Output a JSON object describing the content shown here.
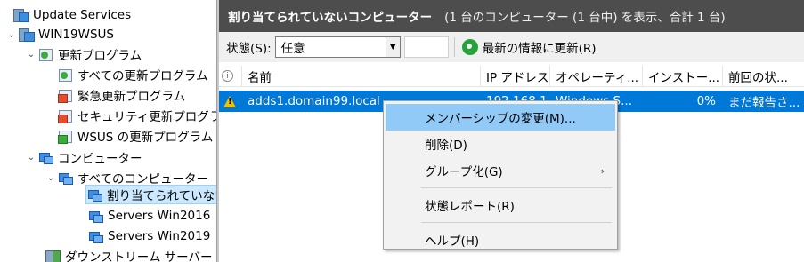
{
  "tree": {
    "root": "Update Services",
    "server": "WIN19WSUS",
    "updates": "更新プログラム",
    "all_updates": "すべての更新プログラム",
    "critical_updates": "緊急更新プログラム",
    "security_updates": "セキュリティ更新プログラ",
    "wsus_updates": "WSUS の更新プログラム",
    "computers": "コンピューター",
    "all_computers": "すべてのコンピューター",
    "unassigned": "割り当てられていない",
    "group_win2016": "Servers Win2016",
    "group_win2019": "Servers Win2019",
    "downstream": "ダウンストリーム サーバー"
  },
  "header": {
    "title": "割り当てられていないコンピューター",
    "info": "(1 台のコンピューター (1 台中) を表示、合計 1 台)"
  },
  "toolbar": {
    "status_label": "状態(S):",
    "status_value": "任意",
    "refresh_label": "最新の情報に更新(R)"
  },
  "table": {
    "columns": [
      "名前",
      "IP アドレス",
      "オペレーティ...",
      "インストー...",
      "前回の状..."
    ],
    "rows": [
      {
        "name": "adds1.domain99.local",
        "ip": "192.168.1.1",
        "os": "Windows S...",
        "installed": "0%",
        "last_status": "まだ報告さ..."
      }
    ]
  },
  "context_menu": {
    "items": [
      "メンバーシップの変更(M)...",
      "削除(D)",
      "グループ化(G)",
      "状態レポート(R)",
      "ヘルプ(H)"
    ]
  }
}
